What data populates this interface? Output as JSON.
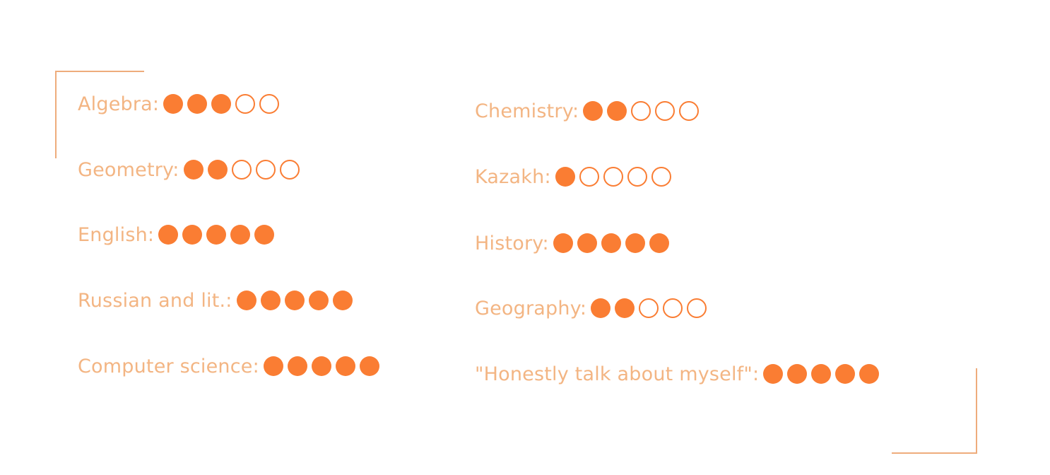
{
  "colors": {
    "accent": "#fa7d33",
    "label": "#f3b583",
    "frame": "#eeac7c"
  },
  "max_rating": 5,
  "left_column": [
    {
      "label": "Algebra:",
      "rating": 3
    },
    {
      "label": "Geometry:",
      "rating": 2
    },
    {
      "label": "English:",
      "rating": 5
    },
    {
      "label": "Russian and lit.:",
      "rating": 5
    },
    {
      "label": "Computer science:",
      "rating": 5
    }
  ],
  "right_column": [
    {
      "label": "Chemistry:",
      "rating": 2
    },
    {
      "label": "Kazakh:",
      "rating": 1
    },
    {
      "label": "History:",
      "rating": 5
    },
    {
      "label": "Geography:",
      "rating": 2
    },
    {
      "label": "\"Honestly talk about myself\":",
      "rating": 5
    }
  ]
}
